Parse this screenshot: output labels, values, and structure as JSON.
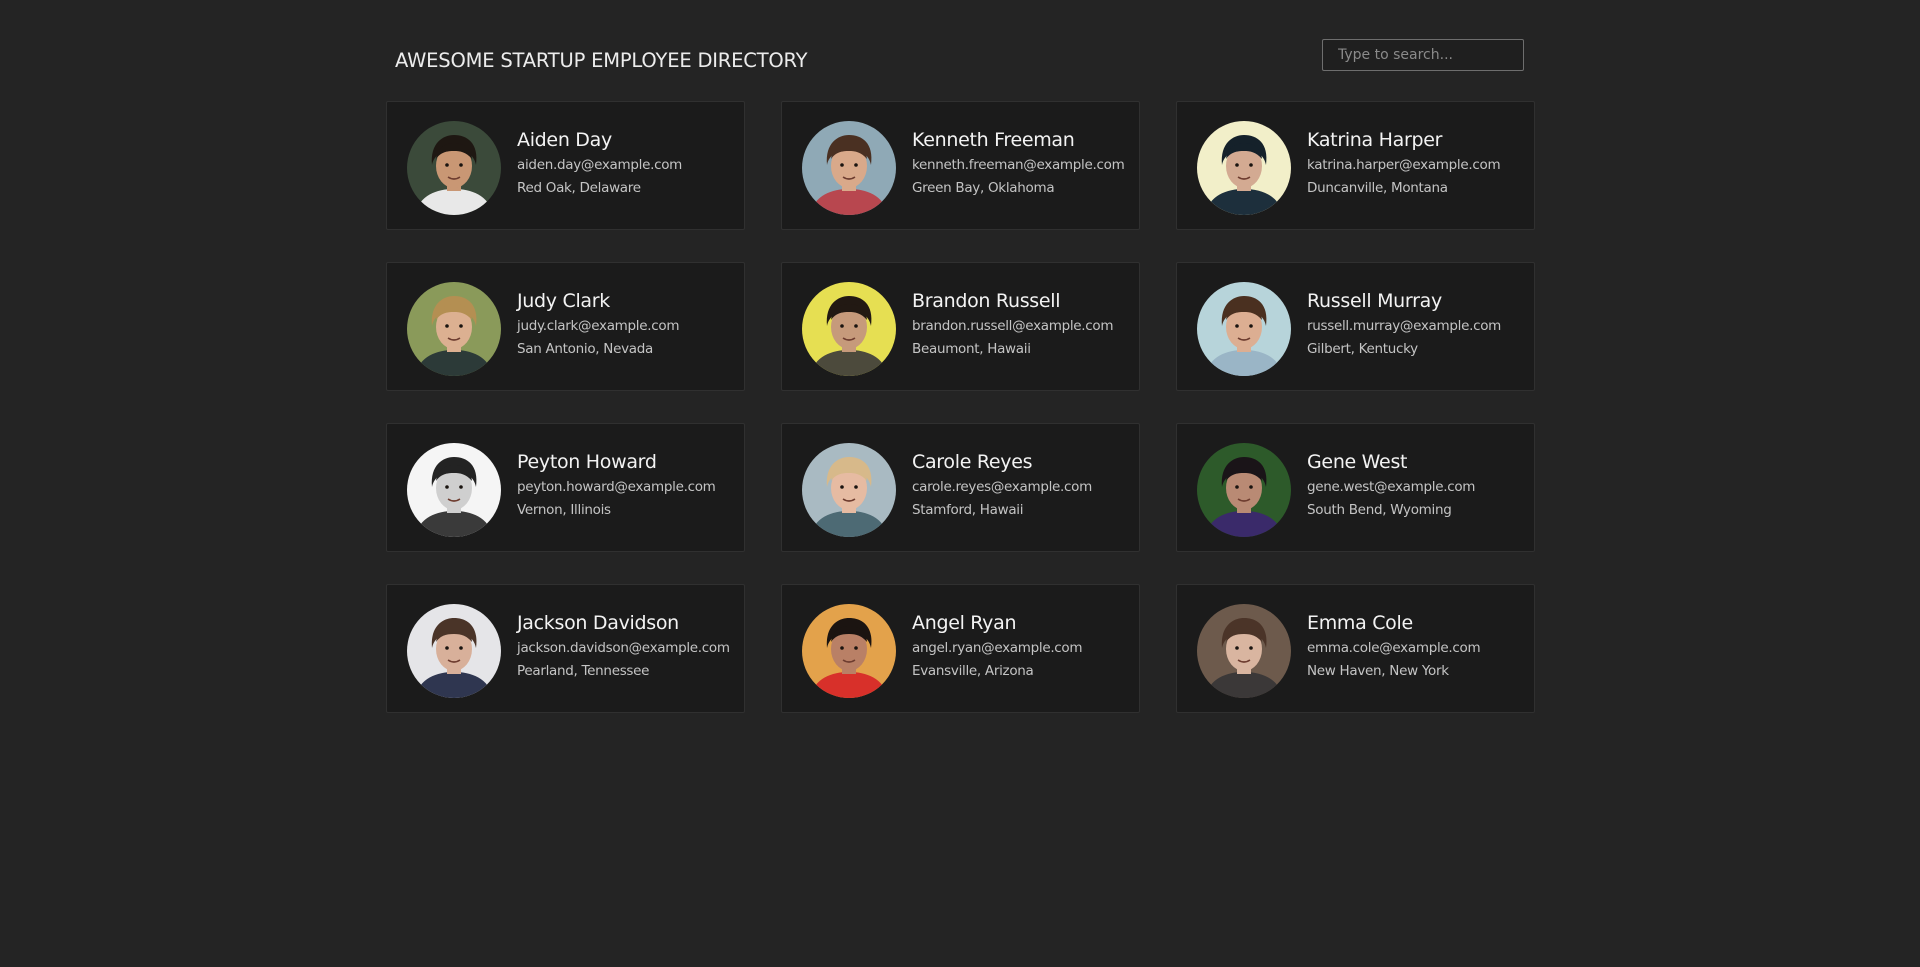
{
  "header": {
    "title": "AWESOME STARTUP EMPLOYEE DIRECTORY",
    "search_placeholder": "Type to search...",
    "search_value": ""
  },
  "employees": [
    {
      "name": "Aiden Day",
      "email": "aiden.day@example.com",
      "location": "Red Oak, Delaware",
      "photo": {
        "bg": "#3b4a3a",
        "skin": "#c99774",
        "hair": "#1e1712",
        "shirt": "#e8e8e8"
      }
    },
    {
      "name": "Kenneth Freeman",
      "email": "kenneth.freeman@example.com",
      "location": "Green Bay, Oklahoma",
      "photo": {
        "bg": "#8fa9b6",
        "skin": "#d9a98a",
        "hair": "#4a3022",
        "shirt": "#b8474f"
      }
    },
    {
      "name": "Katrina Harper",
      "email": "katrina.harper@example.com",
      "location": "Duncanville, Montana",
      "photo": {
        "bg": "#f2efc9",
        "skin": "#d3aa92",
        "hair": "#15212a",
        "shirt": "#1d2f3c"
      }
    },
    {
      "name": "Judy Clark",
      "email": "judy.clark@example.com",
      "location": "San Antonio, Nevada",
      "photo": {
        "bg": "#8a9a5a",
        "skin": "#dcb091",
        "hair": "#b48f52",
        "shirt": "#2c3a38"
      }
    },
    {
      "name": "Brandon Russell",
      "email": "brandon.russell@example.com",
      "location": "Beaumont, Hawaii",
      "photo": {
        "bg": "#e6df52",
        "skin": "#c69a7b",
        "hair": "#221913",
        "shirt": "#4c4a3c"
      }
    },
    {
      "name": "Russell Murray",
      "email": "russell.murray@example.com",
      "location": "Gilbert, Kentucky",
      "photo": {
        "bg": "#b7d4da",
        "skin": "#dcae92",
        "hair": "#4a3020",
        "shirt": "#9ab5c6"
      }
    },
    {
      "name": "Peyton Howard",
      "email": "peyton.howard@example.com",
      "location": "Vernon, Illinois",
      "photo": {
        "bg": "#f5f5f5",
        "skin": "#cfcfcf",
        "hair": "#232323",
        "shirt": "#3a3a3a"
      }
    },
    {
      "name": "Carole Reyes",
      "email": "carole.reyes@example.com",
      "location": "Stamford, Hawaii",
      "photo": {
        "bg": "#a9bac2",
        "skin": "#e6bba2",
        "hair": "#d7b98a",
        "shirt": "#4d6a74"
      }
    },
    {
      "name": "Gene West",
      "email": "gene.west@example.com",
      "location": "South Bend, Wyoming",
      "photo": {
        "bg": "#2d5a2a",
        "skin": "#b98a74",
        "hair": "#1a1418",
        "shirt": "#3a2a6a"
      }
    },
    {
      "name": "Jackson Davidson",
      "email": "jackson.davidson@example.com",
      "location": "Pearland, Tennessee",
      "photo": {
        "bg": "#e5e5e8",
        "skin": "#d8b09a",
        "hair": "#4a3428",
        "shirt": "#2f3650"
      }
    },
    {
      "name": "Angel Ryan",
      "email": "angel.ryan@example.com",
      "location": "Evansville, Arizona",
      "photo": {
        "bg": "#e3a24b",
        "skin": "#b98066",
        "hair": "#1b1411",
        "shirt": "#d8302a"
      }
    },
    {
      "name": "Emma Cole",
      "email": "emma.cole@example.com",
      "location": "New Haven, New York",
      "photo": {
        "bg": "#6d5a4c",
        "skin": "#d9b5a0",
        "hair": "#4b3428",
        "shirt": "#3b3838"
      }
    }
  ]
}
